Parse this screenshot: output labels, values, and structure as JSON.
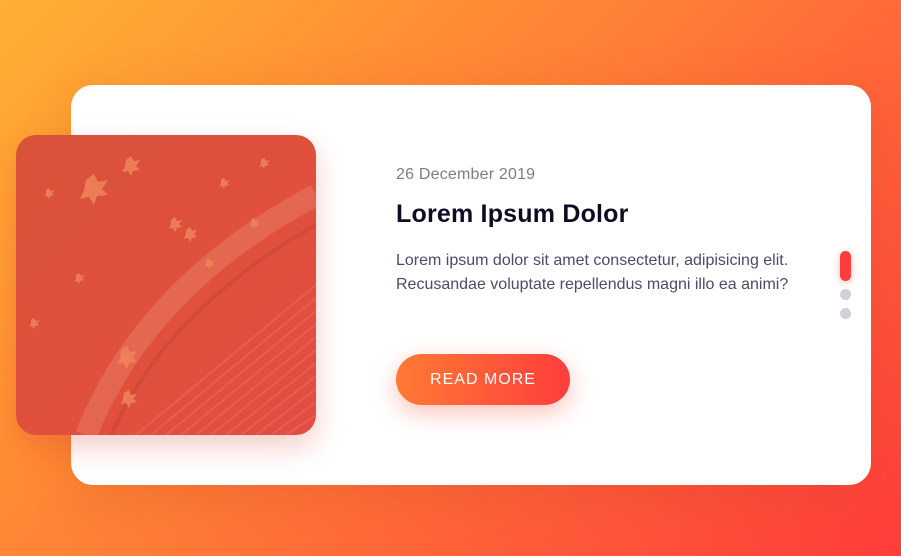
{
  "post": {
    "date": "26 December 2019",
    "title": "Lorem Ipsum Dolor",
    "text": "Lorem ipsum dolor sit amet consectetur, adipisicing elit. Recusandae voluptate repellendus magni illo ea animi?",
    "button_label": "READ MORE"
  },
  "slider": {
    "total_slides": 3,
    "active_index": 0
  },
  "colors": {
    "accent": "#ff3d3d",
    "accent_start": "#ff7a33",
    "title": "#0d0c22",
    "body_text": "#4e4a67",
    "date_text": "#7b7d8e",
    "inactive_dot": "#cfd2d8"
  }
}
